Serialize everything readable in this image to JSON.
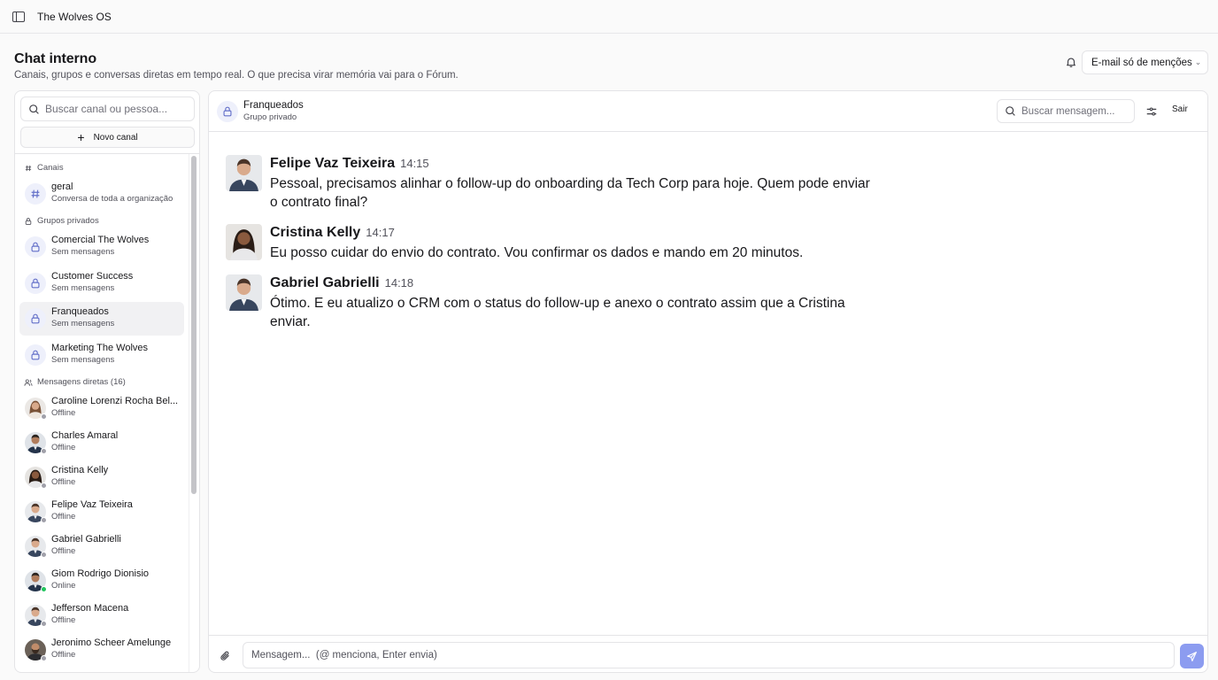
{
  "app": {
    "title": "The Wolves OS"
  },
  "page": {
    "title": "Chat interno",
    "subtitle": "Canais, grupos e conversas diretas em tempo real. O que precisa virar memória vai para o Fórum.",
    "notif_label": "E-mail só de menções"
  },
  "sidebar": {
    "search_placeholder": "Buscar canal ou pessoa...",
    "new_channel": "Novo canal",
    "channels_header": "Canais",
    "channels": [
      {
        "name": "geral",
        "sub": "Conversa de toda a organização"
      }
    ],
    "groups_header": "Grupos privados",
    "groups": [
      {
        "name": "Comercial The Wolves",
        "sub": "Sem mensagens"
      },
      {
        "name": "Customer Success",
        "sub": "Sem mensagens"
      },
      {
        "name": "Franqueados",
        "sub": "Sem mensagens"
      },
      {
        "name": "Marketing The Wolves",
        "sub": "Sem mensagens"
      }
    ],
    "dm_header": "Mensagens diretas (16)",
    "dms": [
      {
        "name": "Caroline Lorenzi Rocha Bel...",
        "status": "Offline"
      },
      {
        "name": "Charles Amaral",
        "status": "Offline"
      },
      {
        "name": "Cristina Kelly",
        "status": "Offline"
      },
      {
        "name": "Felipe Vaz Teixeira",
        "status": "Offline"
      },
      {
        "name": "Gabriel Gabrielli",
        "status": "Offline"
      },
      {
        "name": "Giom Rodrigo Dionisio",
        "status": "Online"
      },
      {
        "name": "Jefferson Macena",
        "status": "Offline"
      },
      {
        "name": "Jeronimo Scheer Amelunge",
        "status": "Offline"
      }
    ]
  },
  "chat": {
    "name": "Franqueados",
    "sub": "Grupo privado",
    "search_placeholder": "Buscar mensagem...",
    "leave": "Sair",
    "messages": [
      {
        "author": "Felipe Vaz Teixeira",
        "time": "14:15",
        "text": "Pessoal, precisamos alinhar o follow-up do onboarding da Tech Corp para hoje. Quem pode enviar o contrato final?"
      },
      {
        "author": "Cristina Kelly",
        "time": "14:17",
        "text": "Eu posso cuidar do envio do contrato. Vou confirmar os dados e mando em 20 minutos."
      },
      {
        "author": "Gabriel Gabrielli",
        "time": "14:18",
        "text": "Ótimo. E eu atualizo o CRM com o status do follow-up e anexo o contrato assim que a Cristina enviar."
      }
    ],
    "compose_placeholder": "Mensagem...  (@ menciona, Enter envia)"
  },
  "colors": {
    "accent": "#8c9cf0",
    "online": "#22c55e",
    "offline": "#a1a1aa"
  }
}
